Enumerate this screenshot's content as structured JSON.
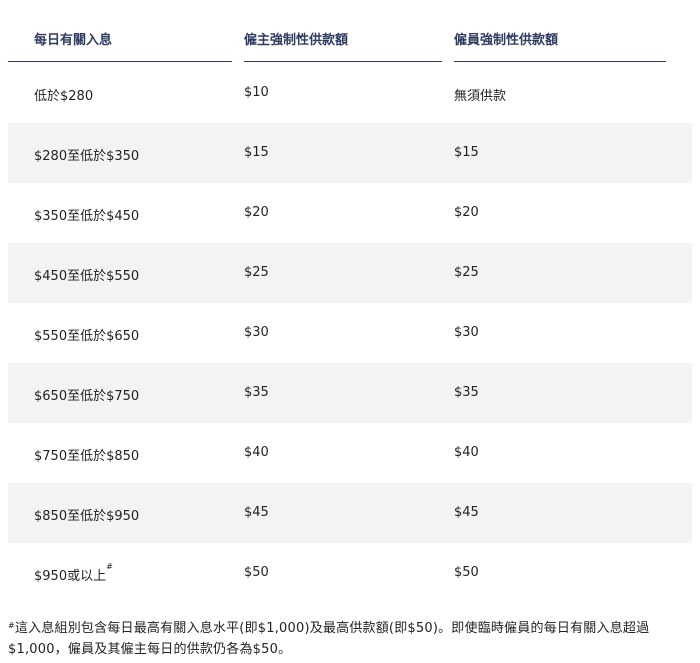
{
  "table": {
    "headers": [
      "每日有關入息",
      "僱主強制性供款額",
      "僱員強制性供款額"
    ],
    "rows": [
      {
        "income": "低於$280",
        "employer": "$10",
        "employee": "無須供款",
        "mark": ""
      },
      {
        "income": "$280至低於$350",
        "employer": "$15",
        "employee": "$15",
        "mark": ""
      },
      {
        "income": "$350至低於$450",
        "employer": "$20",
        "employee": "$20",
        "mark": ""
      },
      {
        "income": "$450至低於$550",
        "employer": "$25",
        "employee": "$25",
        "mark": ""
      },
      {
        "income": "$550至低於$650",
        "employer": "$30",
        "employee": "$30",
        "mark": ""
      },
      {
        "income": "$650至低於$750",
        "employer": "$35",
        "employee": "$35",
        "mark": ""
      },
      {
        "income": "$750至低於$850",
        "employer": "$40",
        "employee": "$40",
        "mark": ""
      },
      {
        "income": "$850至低於$950",
        "employer": "$45",
        "employee": "$45",
        "mark": ""
      },
      {
        "income": "$950或以上",
        "employer": "$50",
        "employee": "$50",
        "mark": "#"
      }
    ]
  },
  "footnote": {
    "mark": "#",
    "line1": "這入息組別包含每日最高有關入息水平(即$1,000)及最高供款額(即$50)。即使臨時僱員的每日有關入息超過",
    "line2": "$1,000，僱員及其僱主每日的供款仍各為$50。"
  }
}
